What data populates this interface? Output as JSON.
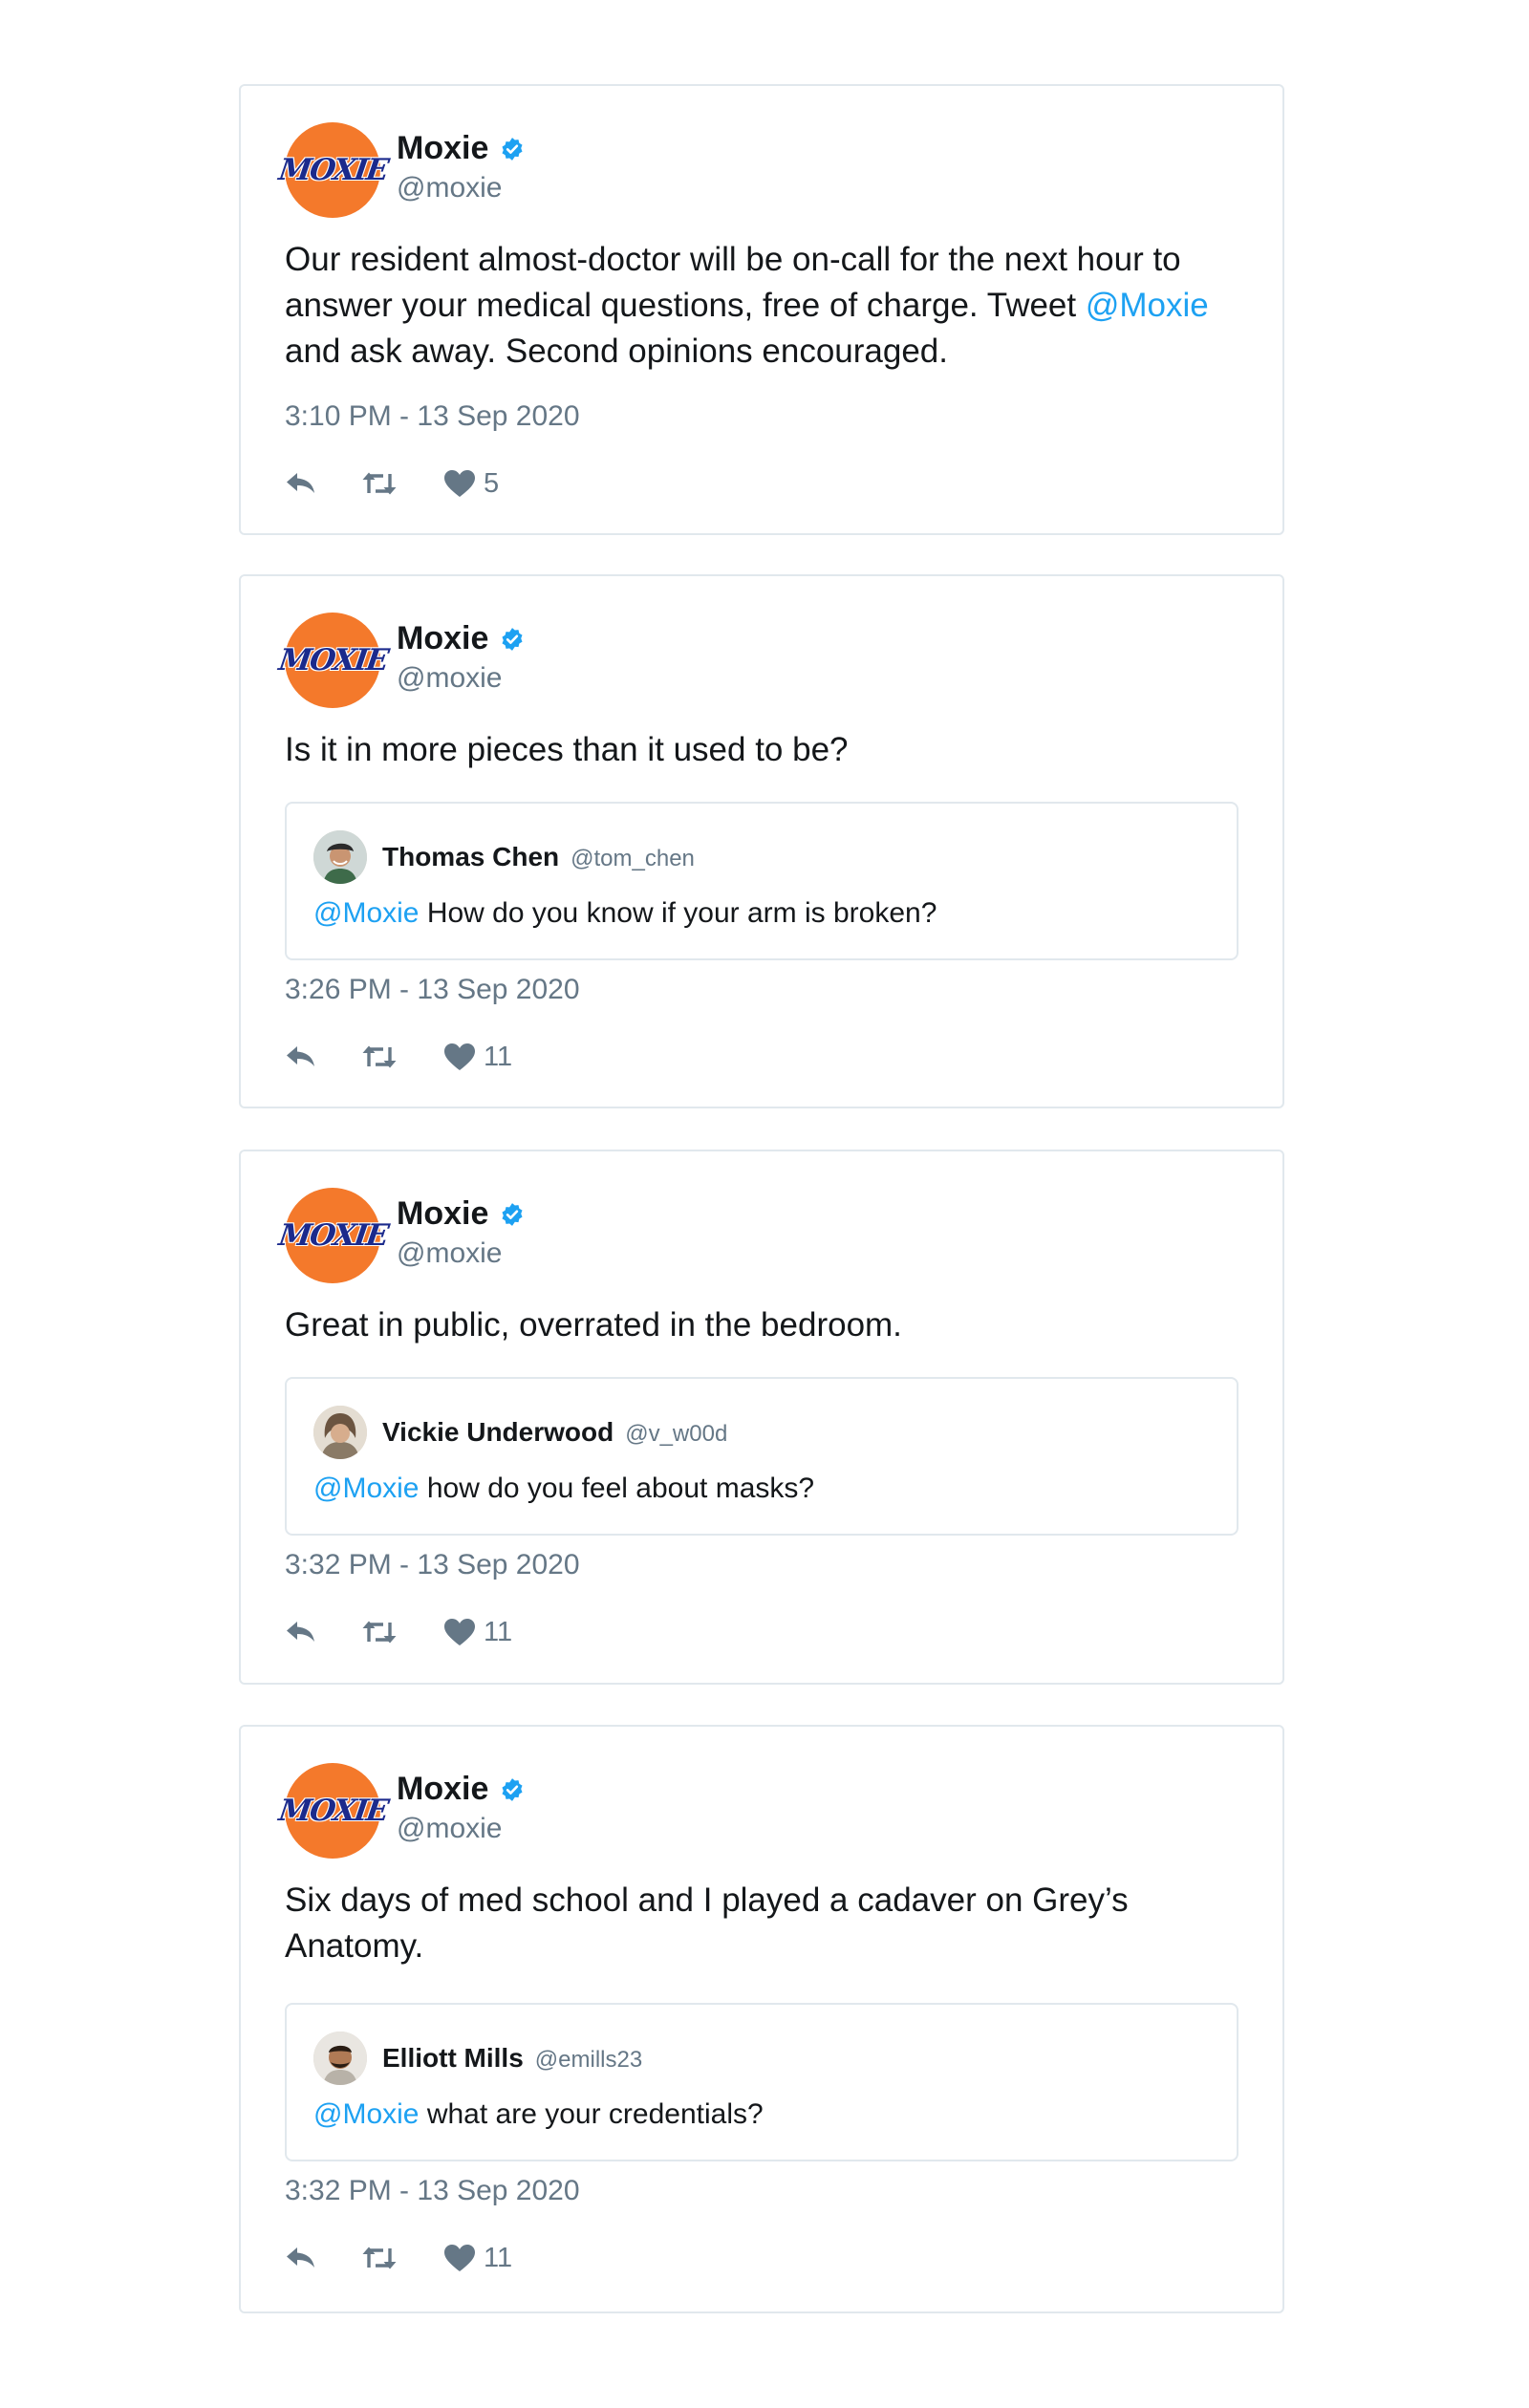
{
  "colors": {
    "link": "#1da1f2",
    "muted": "#657786",
    "avatar_bg": "#f4792b",
    "logo_text": "#1b2a8c",
    "verified": "#1da1f2"
  },
  "icons": {
    "reply": "reply-icon",
    "retweet": "retweet-icon",
    "like": "heart-icon",
    "verified": "verified-badge-icon"
  },
  "tweets": [
    {
      "author": {
        "name": "Moxie",
        "handle": "@moxie",
        "logo_text": "MOXIE"
      },
      "text": {
        "before": "Our resident almost-doctor will be on-call for the next hour to answer your medical questions, free of charge. Tweet ",
        "mention": "@Moxie",
        "after": " and ask away. Second opinions encouraged."
      },
      "timestamp": "3:10 PM - 13 Sep 2020",
      "likes": "5"
    },
    {
      "author": {
        "name": "Moxie",
        "handle": "@moxie",
        "logo_text": "MOXIE"
      },
      "text": "Is it in more pieces than it used to be?",
      "quote": {
        "name": "Thomas Chen",
        "handle": "@tom_chen",
        "mention": "@Moxie",
        "text": " How do you know if your arm is broken?"
      },
      "timestamp": "3:26 PM - 13 Sep 2020",
      "likes": "11"
    },
    {
      "author": {
        "name": "Moxie",
        "handle": "@moxie",
        "logo_text": "MOXIE"
      },
      "text": "Great in public, overrated in the bedroom.",
      "quote": {
        "name": "Vickie Underwood",
        "handle": "@v_w00d",
        "mention": "@Moxie",
        "text": " how do you feel about masks?"
      },
      "timestamp": "3:32 PM - 13 Sep 2020",
      "likes": "11"
    },
    {
      "author": {
        "name": "Moxie",
        "handle": "@moxie",
        "logo_text": "MOXIE"
      },
      "text": "Six days of med school and I played a cadaver on Grey’s Anatomy.",
      "quote": {
        "name": "Elliott Mills",
        "handle": "@emills23",
        "mention": "@Moxie",
        "text": " what are your credentials?"
      },
      "timestamp": "3:32 PM - 13 Sep 2020",
      "likes": "11"
    }
  ]
}
